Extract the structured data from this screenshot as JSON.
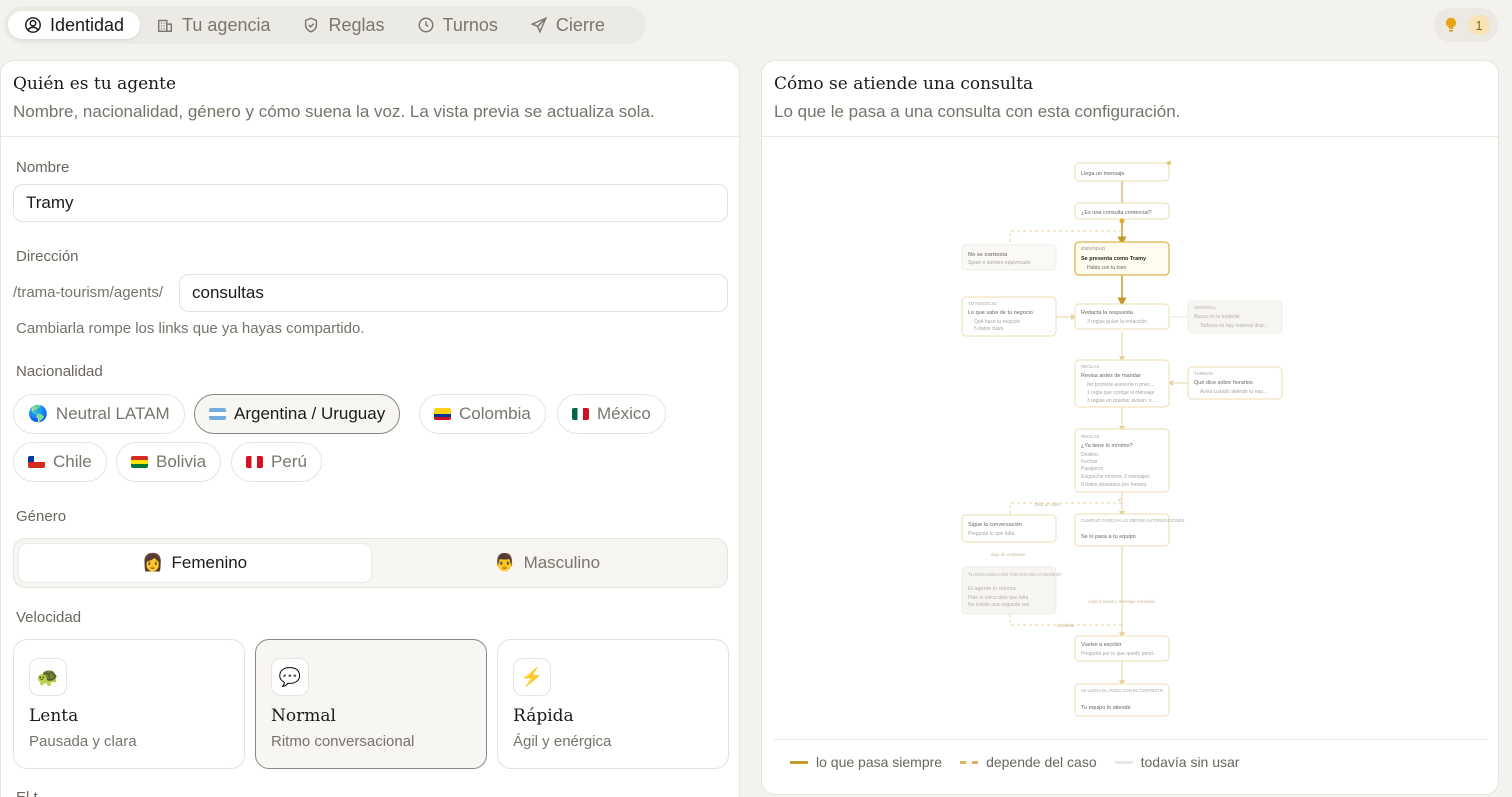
{
  "tabs": [
    {
      "label": "Identidad",
      "icon": "user-circle-icon"
    },
    {
      "label": "Tu agencia",
      "icon": "building-icon"
    },
    {
      "label": "Reglas",
      "icon": "shield-icon"
    },
    {
      "label": "Turnos",
      "icon": "clock-icon"
    },
    {
      "label": "Cierre",
      "icon": "send-icon"
    }
  ],
  "tips": {
    "count": "1",
    "icon": "lightbulb-icon",
    "color": "#e8a317"
  },
  "left": {
    "title": "Quién es tu agente",
    "subtitle": "Nombre, nacionalidad, género y cómo suena la voz. La vista previa se actualiza sola.",
    "name_label": "Nombre",
    "name_value": "Tramy",
    "direction_label": "Dirección",
    "direction_prefix": "/trama-tourism/agents/",
    "direction_value": "consultas",
    "direction_hint": "Cambiarla rompe los links que ya hayas compartido.",
    "nationality_label": "Nacionalidad",
    "nationalities": [
      {
        "label": "Neutral LATAM",
        "flag": "globe"
      },
      {
        "label": "Argentina / Uruguay",
        "flag": "ar"
      },
      {
        "label": "Colombia",
        "flag": "co"
      },
      {
        "label": "México",
        "flag": "mx"
      },
      {
        "label": "Chile",
        "flag": "cl"
      },
      {
        "label": "Bolivia",
        "flag": "bo"
      },
      {
        "label": "Perú",
        "flag": "pe"
      }
    ],
    "nationality_selected": "Argentina / Uruguay",
    "gender_label": "Género",
    "gender_female": "Femenino",
    "gender_male": "Masculino",
    "gender_female_emoji": "👩",
    "gender_male_emoji": "👨",
    "speed_label": "Velocidad",
    "speeds": [
      {
        "title": "Lenta",
        "sub": "Pausada y clara",
        "emoji": "🐢"
      },
      {
        "title": "Normal",
        "sub": "Ritmo conversacional",
        "emoji": "💬"
      },
      {
        "title": "Rápida",
        "sub": "Ágil y enérgica",
        "emoji": "⚡"
      }
    ],
    "speed_selected": "Normal",
    "next_label": "El t..."
  },
  "right": {
    "title": "Cómo se atiende una consulta",
    "subtitle": "Lo que le pasa a una consulta con esta configuración.",
    "legend": {
      "always": "lo que pasa siempre",
      "depends": "depende del caso",
      "unused": "todavía sin usar"
    },
    "flow": {
      "n1": "Llega un mensaje",
      "n2": "¿Es una consulta comercial?",
      "no_title": "No se contesta",
      "no_sub": "Spam o número equivocado",
      "id_tag": "IDENTIDAD",
      "id_title": "Se presenta como Tramy",
      "id_sub": "Habla con tu tono",
      "biz_tag": "TU NEGOCIO",
      "biz_title": "Lo que sabe de tu negocio",
      "biz_l1": "Qué hace tu negocio",
      "biz_l2": "5 datos clave",
      "draft_title": "Redacta la respuesta",
      "draft_sub": "3 reglas guían la redacción",
      "mat_tag": "MATERIAL",
      "mat_l1": "Busca en tu material",
      "mat_l2": "Todavía no hay material disp...",
      "rev_tag": "REGLAS",
      "rev_title": "Revisa antes de mandar",
      "rev_l1": "No promete asesoría n pnec...",
      "rev_l2": "1 regla que corrige el mensaje",
      "rev_l3": "3 reglas en prueba: avisan, n...",
      "hrs_tag": "TURNOS",
      "hrs_title": "Qué dice sobre horarios",
      "hrs_sub": "Avisa cuándo atiende tu equ...",
      "min_tag": "REGLAS",
      "min_title": "¿Ya tiene lo mínimo?",
      "min_l1": "Destino",
      "min_l2": "Fechas",
      "min_l3": "Pasajeros",
      "min_l4": "Enganche mínimo: 3 mensajes",
      "min_l5": "8 datos deseados (no frenan)",
      "cont_title": "Sigue la conversación",
      "cont_sub": "Pregunta lo que falta",
      "hand_tag": "CUMPLIÓ O RECHÁ LO DEFINE AUTORIZACIONES",
      "hand_title": "Se lo pasa a tu equipo",
      "org_tag": "TU ORGANIZACIÓN TODAVÍA NO LO MANEJÓ",
      "org_title": "El agente lo retoma",
      "org_l1": "Pide el único dato que falta",
      "org_l2": "No insiste una segunda vez",
      "back_title": "Vuelve a escribir",
      "back_sub": "Pregunta por lo que quedó pend...",
      "end_tag": "LE LLEGA EL AVISO CON EL CONTEXTO",
      "end_title": "Tu equipo lo atiende",
      "edge_falta": "falta un dato",
      "edge_si": "sí",
      "edge_dejo": "dejó de contestar",
      "edge_cada": "cada 4 horas y mensaje escalado",
      "edge_probable": "probable"
    }
  }
}
